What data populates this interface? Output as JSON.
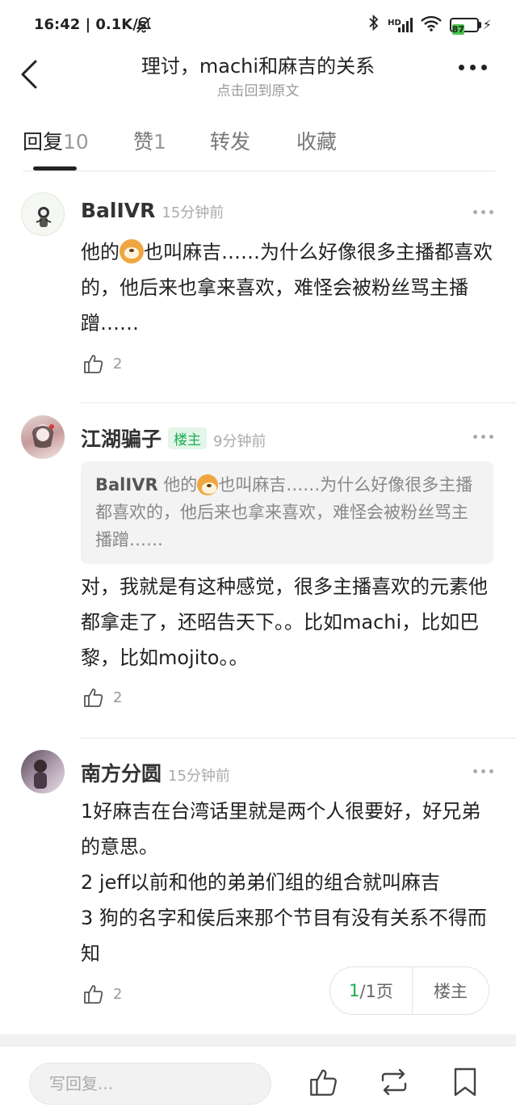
{
  "status": {
    "time": "16:42 | 0.1K/s",
    "battery": "87"
  },
  "header": {
    "title": "理讨，machi和麻吉的关系",
    "subtitle": "点击回到原文"
  },
  "tabs": [
    {
      "label": "回复",
      "count": "10"
    },
    {
      "label": "赞",
      "count": "1"
    },
    {
      "label": "转发",
      "count": ""
    },
    {
      "label": "收藏",
      "count": ""
    }
  ],
  "comments": [
    {
      "author": "BalIVR",
      "time": "15分钟前",
      "text": "他的[dog]也叫麻吉……为什么好像很多主播都喜欢的，他后来也拿来喜欢，难怪会被粉丝骂主播蹭……",
      "text_before": "他的",
      "text_after": "也叫麻吉……为什么好像很多主播都喜欢的，他后来也拿来喜欢，难怪会被粉丝骂主播蹭……",
      "likes": "2"
    },
    {
      "author": "江湖骗子",
      "badge": "楼主",
      "time": "9分钟前",
      "quote_author": "BalIVR",
      "quote_before": "他的",
      "quote_after": "也叫麻吉……为什么好像很多主播都喜欢的，他后来也拿来喜欢，难怪会被粉丝骂主播蹭……",
      "text": "对，我就是有这种感觉，很多主播喜欢的元素他都拿走了，还昭告天下。。比如machi，比如巴黎，比如mojito。。",
      "likes": "2"
    },
    {
      "author": "南方分圆",
      "time": "15分钟前",
      "lines": [
        "1好麻吉在台湾话里就是两个人很要好，好兄弟的意思。",
        "2 jeff以前和他的弟弟们组的组合就叫麻吉",
        "3 狗的名字和侯后来那个节目有没有关系不得而知"
      ],
      "likes": "2"
    }
  ],
  "pager": {
    "current": "1",
    "total": "/1页",
    "owner_only": "楼主"
  },
  "bottom": {
    "reply_placeholder": "写回复..."
  }
}
